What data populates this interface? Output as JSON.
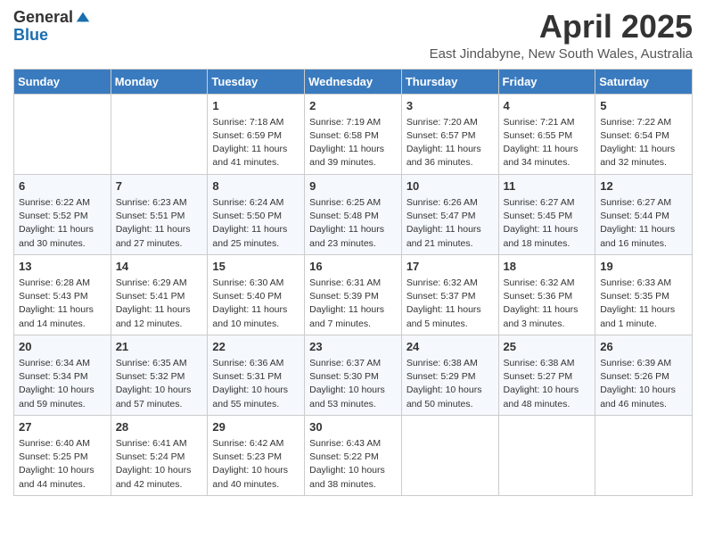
{
  "header": {
    "logo_line1": "General",
    "logo_line2": "Blue",
    "month": "April 2025",
    "location": "East Jindabyne, New South Wales, Australia"
  },
  "days_of_week": [
    "Sunday",
    "Monday",
    "Tuesday",
    "Wednesday",
    "Thursday",
    "Friday",
    "Saturday"
  ],
  "weeks": [
    [
      {
        "num": "",
        "info": ""
      },
      {
        "num": "",
        "info": ""
      },
      {
        "num": "1",
        "info": "Sunrise: 7:18 AM\nSunset: 6:59 PM\nDaylight: 11 hours and 41 minutes."
      },
      {
        "num": "2",
        "info": "Sunrise: 7:19 AM\nSunset: 6:58 PM\nDaylight: 11 hours and 39 minutes."
      },
      {
        "num": "3",
        "info": "Sunrise: 7:20 AM\nSunset: 6:57 PM\nDaylight: 11 hours and 36 minutes."
      },
      {
        "num": "4",
        "info": "Sunrise: 7:21 AM\nSunset: 6:55 PM\nDaylight: 11 hours and 34 minutes."
      },
      {
        "num": "5",
        "info": "Sunrise: 7:22 AM\nSunset: 6:54 PM\nDaylight: 11 hours and 32 minutes."
      }
    ],
    [
      {
        "num": "6",
        "info": "Sunrise: 6:22 AM\nSunset: 5:52 PM\nDaylight: 11 hours and 30 minutes."
      },
      {
        "num": "7",
        "info": "Sunrise: 6:23 AM\nSunset: 5:51 PM\nDaylight: 11 hours and 27 minutes."
      },
      {
        "num": "8",
        "info": "Sunrise: 6:24 AM\nSunset: 5:50 PM\nDaylight: 11 hours and 25 minutes."
      },
      {
        "num": "9",
        "info": "Sunrise: 6:25 AM\nSunset: 5:48 PM\nDaylight: 11 hours and 23 minutes."
      },
      {
        "num": "10",
        "info": "Sunrise: 6:26 AM\nSunset: 5:47 PM\nDaylight: 11 hours and 21 minutes."
      },
      {
        "num": "11",
        "info": "Sunrise: 6:27 AM\nSunset: 5:45 PM\nDaylight: 11 hours and 18 minutes."
      },
      {
        "num": "12",
        "info": "Sunrise: 6:27 AM\nSunset: 5:44 PM\nDaylight: 11 hours and 16 minutes."
      }
    ],
    [
      {
        "num": "13",
        "info": "Sunrise: 6:28 AM\nSunset: 5:43 PM\nDaylight: 11 hours and 14 minutes."
      },
      {
        "num": "14",
        "info": "Sunrise: 6:29 AM\nSunset: 5:41 PM\nDaylight: 11 hours and 12 minutes."
      },
      {
        "num": "15",
        "info": "Sunrise: 6:30 AM\nSunset: 5:40 PM\nDaylight: 11 hours and 10 minutes."
      },
      {
        "num": "16",
        "info": "Sunrise: 6:31 AM\nSunset: 5:39 PM\nDaylight: 11 hours and 7 minutes."
      },
      {
        "num": "17",
        "info": "Sunrise: 6:32 AM\nSunset: 5:37 PM\nDaylight: 11 hours and 5 minutes."
      },
      {
        "num": "18",
        "info": "Sunrise: 6:32 AM\nSunset: 5:36 PM\nDaylight: 11 hours and 3 minutes."
      },
      {
        "num": "19",
        "info": "Sunrise: 6:33 AM\nSunset: 5:35 PM\nDaylight: 11 hours and 1 minute."
      }
    ],
    [
      {
        "num": "20",
        "info": "Sunrise: 6:34 AM\nSunset: 5:34 PM\nDaylight: 10 hours and 59 minutes."
      },
      {
        "num": "21",
        "info": "Sunrise: 6:35 AM\nSunset: 5:32 PM\nDaylight: 10 hours and 57 minutes."
      },
      {
        "num": "22",
        "info": "Sunrise: 6:36 AM\nSunset: 5:31 PM\nDaylight: 10 hours and 55 minutes."
      },
      {
        "num": "23",
        "info": "Sunrise: 6:37 AM\nSunset: 5:30 PM\nDaylight: 10 hours and 53 minutes."
      },
      {
        "num": "24",
        "info": "Sunrise: 6:38 AM\nSunset: 5:29 PM\nDaylight: 10 hours and 50 minutes."
      },
      {
        "num": "25",
        "info": "Sunrise: 6:38 AM\nSunset: 5:27 PM\nDaylight: 10 hours and 48 minutes."
      },
      {
        "num": "26",
        "info": "Sunrise: 6:39 AM\nSunset: 5:26 PM\nDaylight: 10 hours and 46 minutes."
      }
    ],
    [
      {
        "num": "27",
        "info": "Sunrise: 6:40 AM\nSunset: 5:25 PM\nDaylight: 10 hours and 44 minutes."
      },
      {
        "num": "28",
        "info": "Sunrise: 6:41 AM\nSunset: 5:24 PM\nDaylight: 10 hours and 42 minutes."
      },
      {
        "num": "29",
        "info": "Sunrise: 6:42 AM\nSunset: 5:23 PM\nDaylight: 10 hours and 40 minutes."
      },
      {
        "num": "30",
        "info": "Sunrise: 6:43 AM\nSunset: 5:22 PM\nDaylight: 10 hours and 38 minutes."
      },
      {
        "num": "",
        "info": ""
      },
      {
        "num": "",
        "info": ""
      },
      {
        "num": "",
        "info": ""
      }
    ]
  ]
}
